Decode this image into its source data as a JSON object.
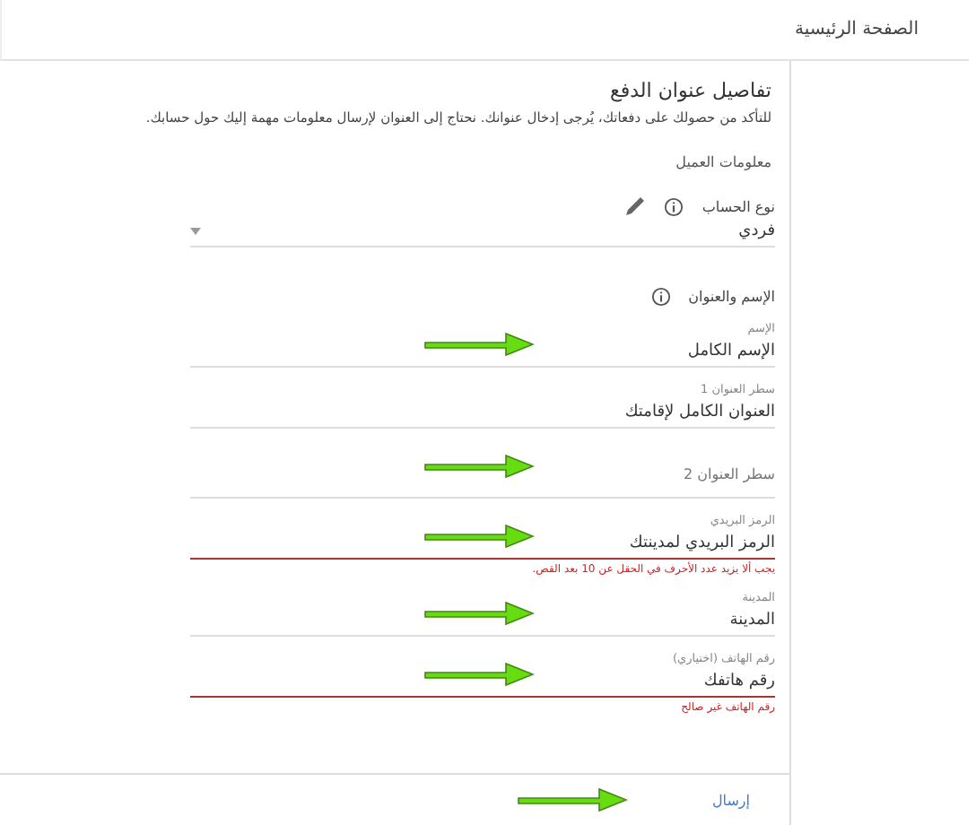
{
  "header": {
    "title": "الصفحة الرئيسية"
  },
  "intro": {
    "title": "تفاصيل عنوان الدفع",
    "description": "للتأكد من حصولك على دفعاتك، يُرجى إدخال عنوانك. نحتاج إلى العنوان لإرسال معلومات مهمة إليك حول حسابك."
  },
  "section_title": "معلومات العميل",
  "fields": [
    {
      "kind": "select",
      "label": "نوع الحساب",
      "value": "فردي",
      "info": true,
      "editable": true,
      "annotated": false
    },
    {
      "kind": "heading",
      "label": "الإسم والعنوان",
      "info": true,
      "annotated": false
    },
    {
      "kind": "text",
      "label": "الإسم",
      "value": "الإسم الكامل",
      "annotated": true
    },
    {
      "kind": "text",
      "label": "سطر العنوان 1",
      "value": "العنوان الكامل لإقامتك",
      "annotated": false
    },
    {
      "kind": "empty",
      "placeholder": "سطر العنوان 2",
      "annotated": true
    },
    {
      "kind": "text",
      "label": "الرمز البريدي",
      "value": "الرمز البريدي لمدينتك",
      "error": "يجب ألا يزيد عدد الأحرف في الحقل عن 10 بعد القص.",
      "annotated": true
    },
    {
      "kind": "text",
      "label": "المدينة",
      "value": "المدينة",
      "annotated": true
    },
    {
      "kind": "text",
      "label": "رقم الهاتف (اختياري)",
      "value": "رقم هاتفك",
      "error": "رقم الهاتف غير صالح",
      "annotated": true
    }
  ],
  "submit": {
    "label": "إرسال",
    "annotated": true
  }
}
